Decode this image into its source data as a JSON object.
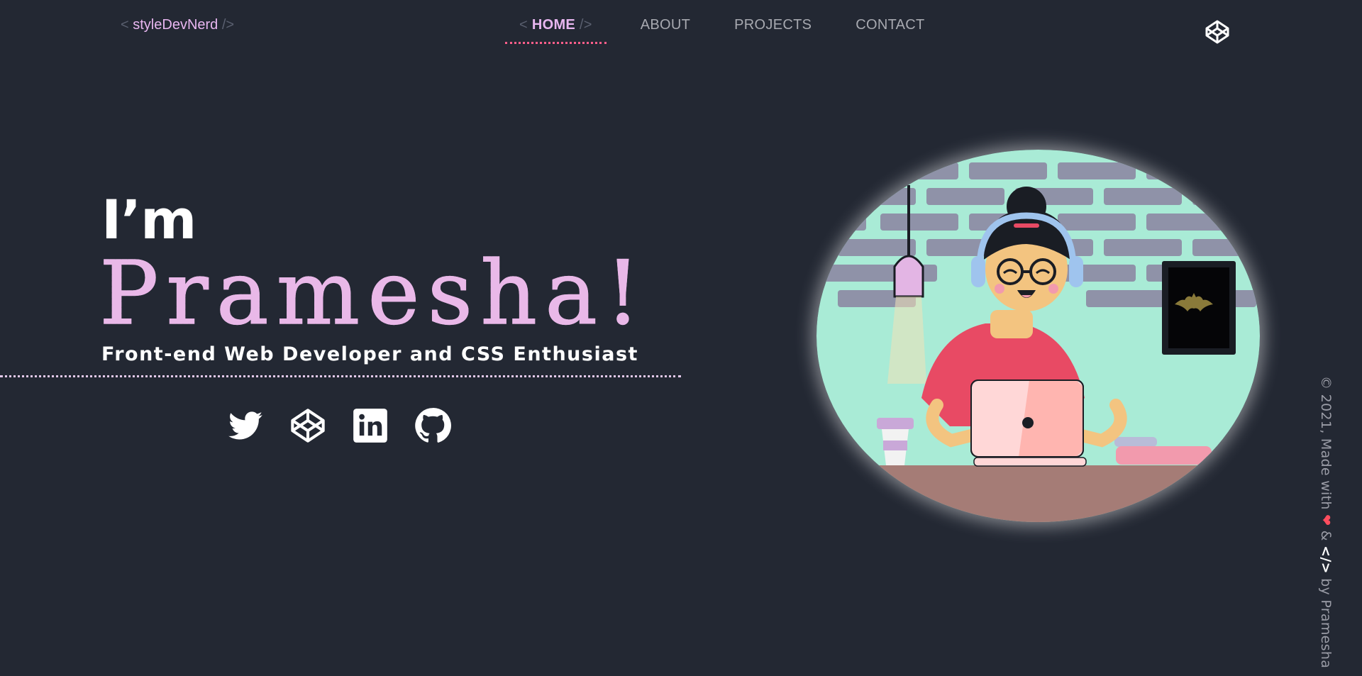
{
  "logo": {
    "open": "<",
    "text": "styleDevNerd",
    "close": "/>"
  },
  "nav": {
    "items": [
      {
        "label": "HOME",
        "open": "<",
        "close": "/>"
      },
      {
        "label": "ABOUT"
      },
      {
        "label": "PROJECTS"
      },
      {
        "label": "CONTACT"
      }
    ]
  },
  "hero": {
    "intro": "I’m",
    "name": "Pramesha!",
    "tagline": "Front-end Web Developer and CSS Enthusiast"
  },
  "socials": [
    "twitter-icon",
    "codepen-icon",
    "linkedin-icon",
    "github-icon"
  ],
  "footer": {
    "prefix": "© 2021, Made with",
    "amp": "&",
    "suffix": "by Pramesha",
    "heart": "❤",
    "code": "</>"
  },
  "colors": {
    "background": "#232833",
    "accent": "#e8b6f0",
    "underline": "#ff5e8a",
    "nav_text": "#a7a9b0"
  }
}
